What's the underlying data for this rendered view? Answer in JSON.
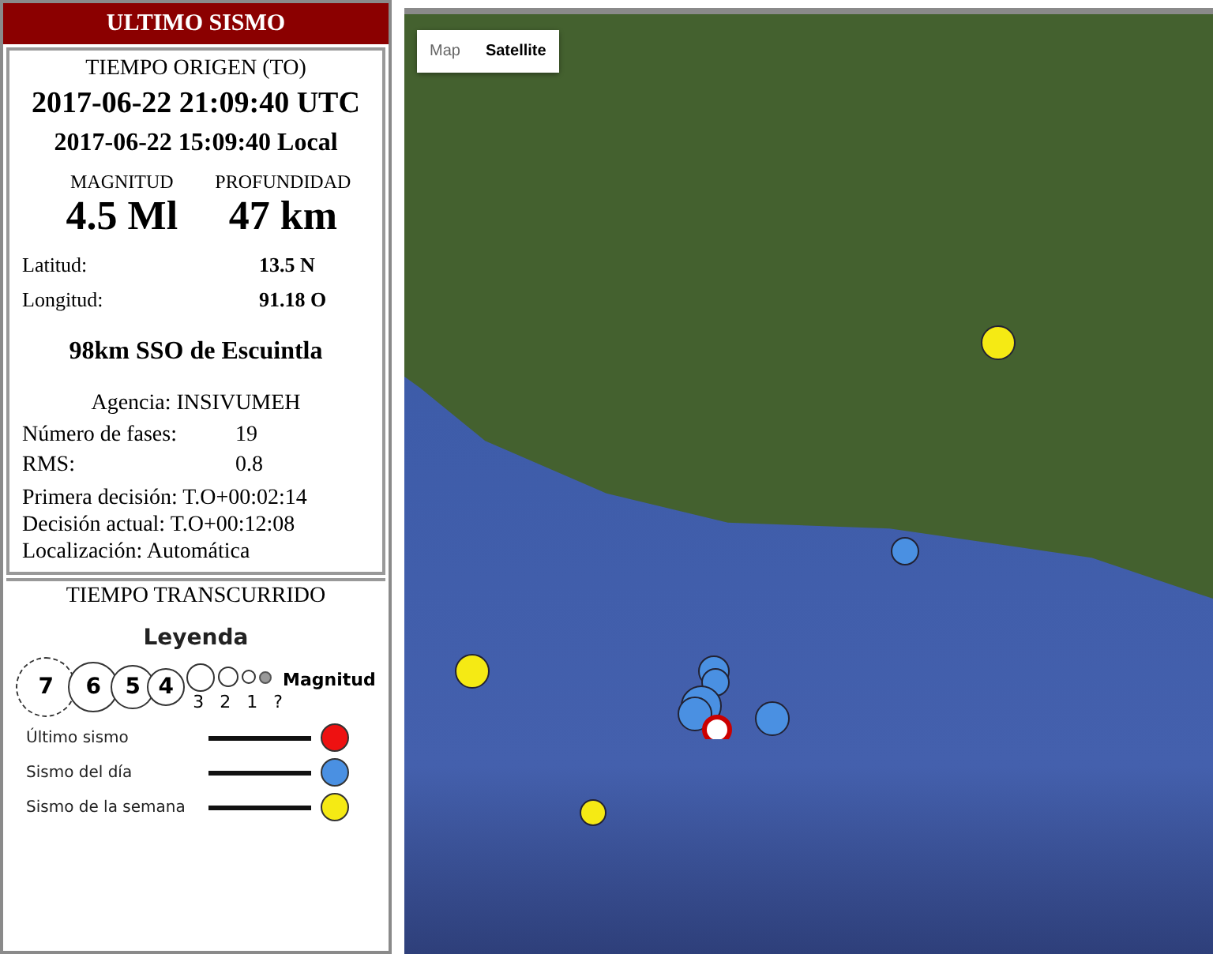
{
  "panel": {
    "title": "ULTIMO SISMO",
    "origin_heading": "TIEMPO ORIGEN (TO)",
    "utc_time": "2017-06-22 21:09:40 UTC",
    "local_time": "2017-06-22 15:09:40 Local",
    "magnitude": {
      "label": "MAGNITUD",
      "value": "4.5 Ml"
    },
    "depth": {
      "label": "PROFUNDIDAD",
      "value": "47 km"
    },
    "coordinates": [
      {
        "label": "Latitud:",
        "value": "13.5 N"
      },
      {
        "label": "Longitud:",
        "value": "91.18 O"
      }
    ],
    "location": "98km SSO de Escuintla",
    "agency": "Agencia: INSIVUMEH",
    "stats": [
      {
        "label": "Número de fases:",
        "value": "19"
      },
      {
        "label": "RMS:",
        "value": "0.8"
      }
    ],
    "decisions": [
      "Primera decisión: T.O+00:02:14",
      "Decisión actual: T.O+00:12:08",
      "Localización: Automática"
    ]
  },
  "elapsed_heading": "TIEMPO TRANSCURRIDO",
  "legend": {
    "title": "Leyenda",
    "big_sizes": [
      "7",
      "6",
      "5",
      "4"
    ],
    "small_sizes": [
      "3",
      "2",
      "1",
      "?"
    ],
    "magnitude_label": "Magnitud",
    "entries": [
      {
        "label": "Último sismo",
        "color": "#ee1111"
      },
      {
        "label": "Sismo del día",
        "color": "#4a90e2"
      },
      {
        "label": "Sismo de la semana",
        "color": "#f5ea14"
      }
    ]
  },
  "map": {
    "types": [
      {
        "label": "Map",
        "selected": false
      },
      {
        "label": "Satellite",
        "selected": true
      }
    ],
    "quakes": [
      {
        "kind": "week"
      },
      {
        "kind": "day"
      },
      {
        "kind": "week"
      },
      {
        "kind": "week"
      },
      {
        "kind": "day"
      },
      {
        "kind": "day"
      },
      {
        "kind": "day"
      },
      {
        "kind": "day"
      },
      {
        "kind": "day"
      },
      {
        "kind": "last"
      }
    ]
  }
}
